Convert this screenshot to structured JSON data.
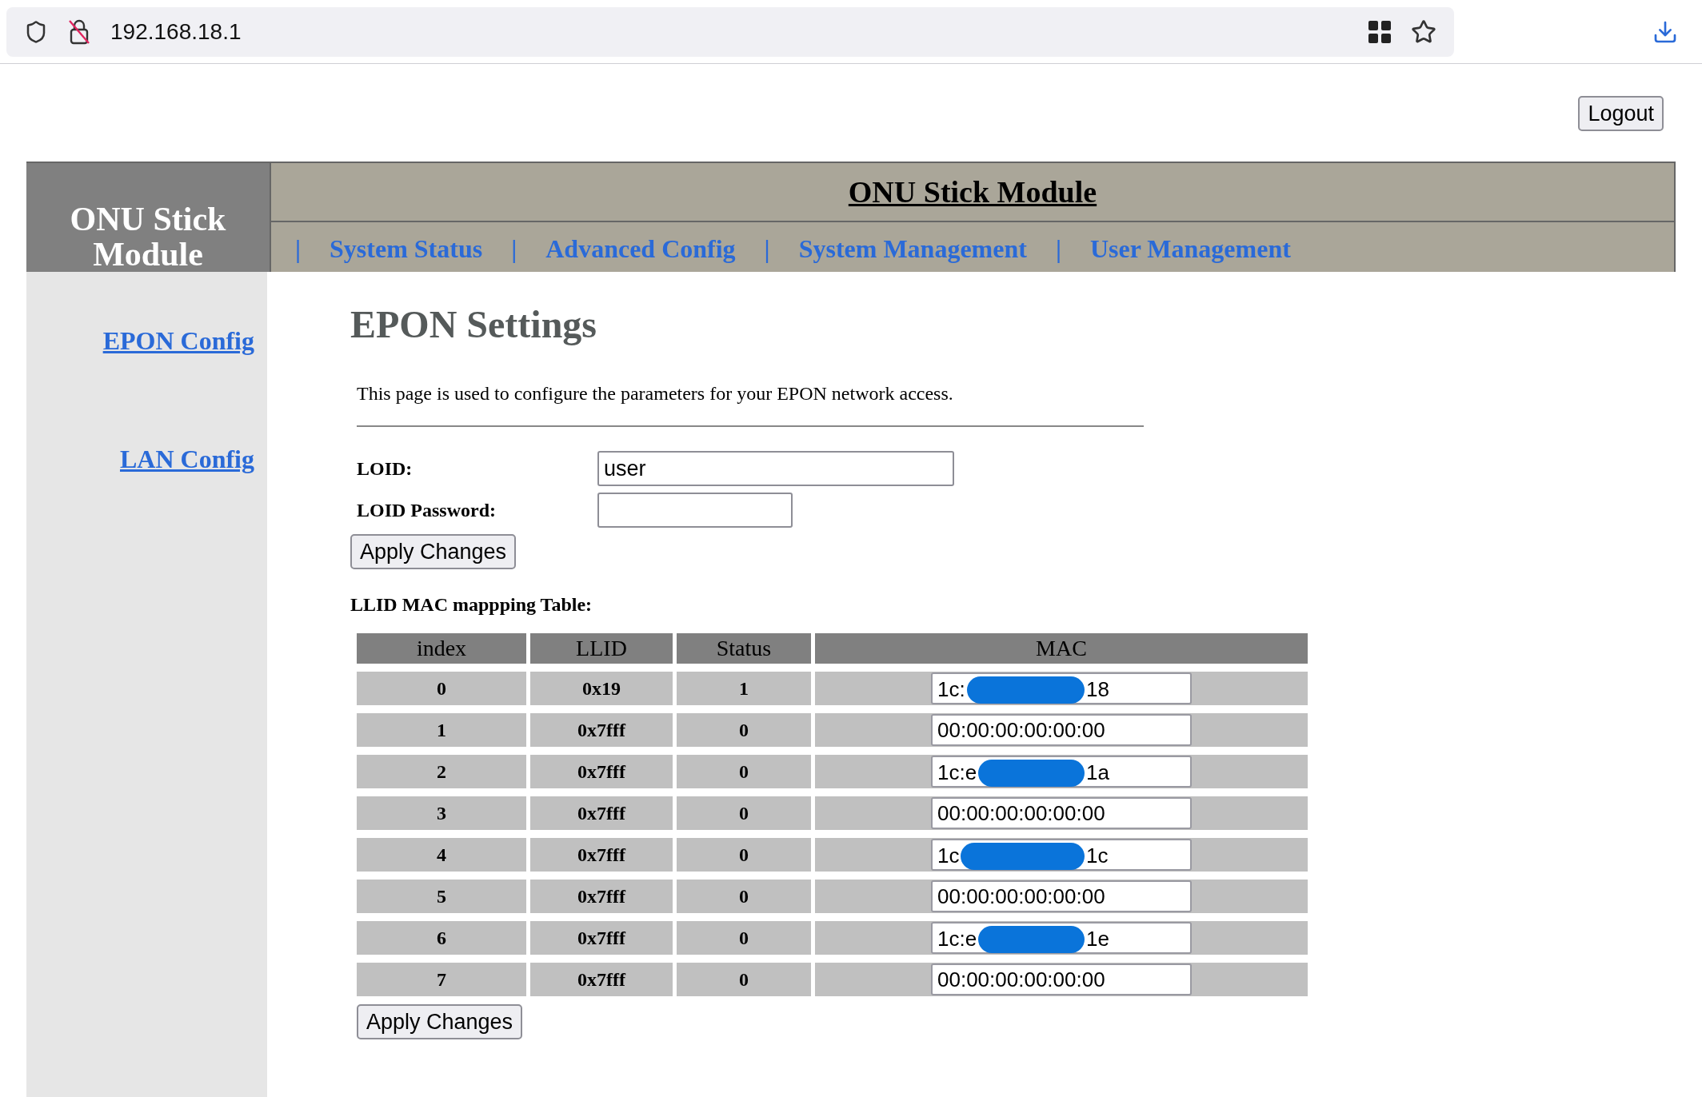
{
  "browser": {
    "url": "192.168.18.1"
  },
  "logout_button": "Logout",
  "header": {
    "brand": "ONU Stick Module",
    "title": "ONU Stick Module",
    "separator": "|",
    "nav": [
      "System Status",
      "Advanced Config",
      "System Management",
      "User Management"
    ]
  },
  "sidebar": {
    "items": [
      {
        "label": "EPON Config"
      },
      {
        "label": "LAN Config"
      }
    ]
  },
  "page": {
    "title": "EPON Settings",
    "description": "This page is used to configure the parameters for your EPON network access.",
    "fields": [
      {
        "label": "LOID:",
        "value": "user",
        "kind": "wide"
      },
      {
        "label": "LOID Password:",
        "kind": "narrow"
      }
    ],
    "apply_button": "Apply Changes",
    "table_title": "LLID MAC mappping Table:",
    "table": {
      "columns": [
        "index",
        "LLID",
        "Status",
        "MAC"
      ],
      "rows": [
        {
          "index": "0",
          "llid": "0x19",
          "status": "1",
          "mac": {
            "kind": "redacted",
            "start": "1c:",
            "end": "18"
          }
        },
        {
          "index": "1",
          "llid": "0x7fff",
          "status": "0",
          "mac": {
            "kind": "plain",
            "value": "00:00:00:00:00:00"
          }
        },
        {
          "index": "2",
          "llid": "0x7fff",
          "status": "0",
          "mac": {
            "kind": "redacted",
            "start": "1c:e",
            "end": "1a"
          }
        },
        {
          "index": "3",
          "llid": "0x7fff",
          "status": "0",
          "mac": {
            "kind": "plain",
            "value": "00:00:00:00:00:00"
          }
        },
        {
          "index": "4",
          "llid": "0x7fff",
          "status": "0",
          "mac": {
            "kind": "redacted",
            "start": "1c",
            "end": "1c"
          }
        },
        {
          "index": "5",
          "llid": "0x7fff",
          "status": "0",
          "mac": {
            "kind": "plain",
            "value": "00:00:00:00:00:00"
          }
        },
        {
          "index": "6",
          "llid": "0x7fff",
          "status": "0",
          "mac": {
            "kind": "redacted",
            "start": "1c:e",
            "end": "1e"
          }
        },
        {
          "index": "7",
          "llid": "0x7fff",
          "status": "0",
          "mac": {
            "kind": "plain",
            "value": "00:00:00:00:00:00"
          }
        }
      ]
    },
    "apply_button_2": "Apply Changes"
  }
}
